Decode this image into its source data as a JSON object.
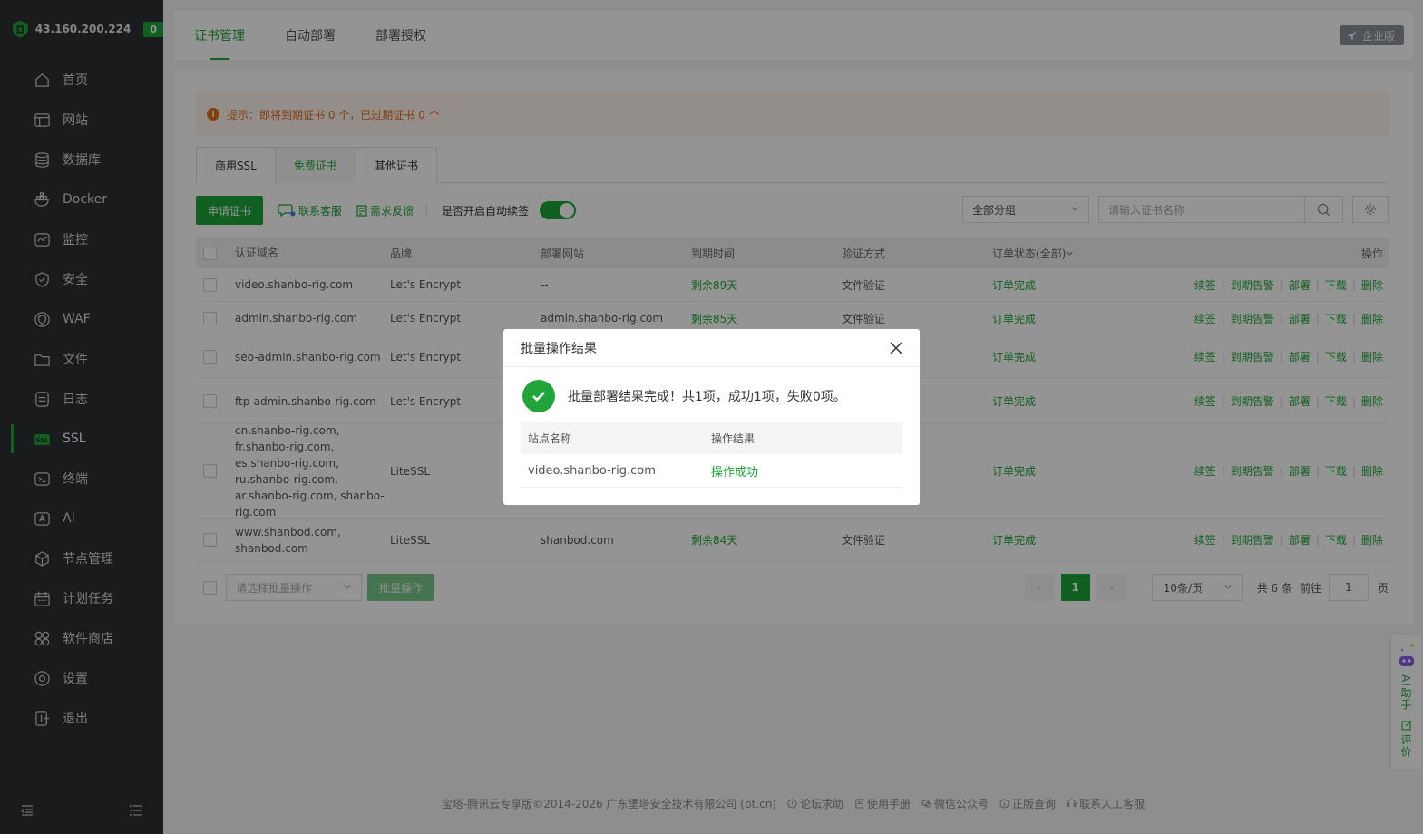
{
  "sidebar": {
    "ip": "43.160.200.224",
    "count": "0",
    "items": [
      {
        "label": "首页",
        "icon": "home-icon"
      },
      {
        "label": "网站",
        "icon": "website-icon"
      },
      {
        "label": "数据库",
        "icon": "database-icon"
      },
      {
        "label": "Docker",
        "icon": "docker-icon"
      },
      {
        "label": "监控",
        "icon": "monitor-icon"
      },
      {
        "label": "安全",
        "icon": "shield-icon"
      },
      {
        "label": "WAF",
        "icon": "waf-icon"
      },
      {
        "label": "文件",
        "icon": "folder-icon"
      },
      {
        "label": "日志",
        "icon": "log-icon"
      },
      {
        "label": "SSL",
        "icon": "ssl-icon"
      },
      {
        "label": "终端",
        "icon": "terminal-icon"
      },
      {
        "label": "AI",
        "icon": "ai-icon"
      },
      {
        "label": "节点管理",
        "icon": "node-icon"
      },
      {
        "label": "计划任务",
        "icon": "calendar-icon"
      },
      {
        "label": "软件商店",
        "icon": "store-icon"
      },
      {
        "label": "设置",
        "icon": "settings-icon"
      },
      {
        "label": "退出",
        "icon": "logout-icon"
      }
    ],
    "active": "SSL"
  },
  "topbar": {
    "tabs": [
      "证书管理",
      "自动部署",
      "部署授权"
    ],
    "enterprise": "企业版"
  },
  "notice": "提示：即将到期证书 0 个，已过期证书 0 个",
  "subtabs": [
    "商用SSL",
    "免费证书",
    "其他证书"
  ],
  "toolbar": {
    "apply": "申请证书",
    "contact": "联系客服",
    "feedback": "需求反馈",
    "auto_renew_label": "是否开启自动续签",
    "auto_renew_on": true,
    "group_select": "全部分组",
    "search_placeholder": "请输入证书名称"
  },
  "table": {
    "headers": [
      "认证域名",
      "品牌",
      "部署网站",
      "到期时间",
      "验证方式",
      "订单状态(全部)",
      "操作"
    ],
    "actions": [
      "续签",
      "到期告警",
      "部署",
      "下载",
      "删除"
    ],
    "rows": [
      {
        "domain": "video.shanbo-rig.com",
        "brand": "Let's Encrypt",
        "site": "--",
        "expire": "剩余89天",
        "verify": "文件验证",
        "status": "订单完成"
      },
      {
        "domain": "admin.shanbo-rig.com",
        "brand": "Let's Encrypt",
        "site": "admin.shanbo-rig.com",
        "expire": "剩余85天",
        "verify": "文件验证",
        "status": "订单完成"
      },
      {
        "domain": "seo-admin.shanbo-rig.com",
        "brand": "Let's Encrypt",
        "site": "",
        "expire": "",
        "verify": "",
        "status": "订单完成"
      },
      {
        "domain": "ftp-admin.shanbo-rig.com",
        "brand": "Let's Encrypt",
        "site": "",
        "expire": "",
        "verify": "",
        "status": "订单完成"
      },
      {
        "domain": "cn.shanbo-rig.com, fr.shanbo-rig.com, es.shanbo-rig.com, ru.shanbo-rig.com, ar.shanbo-rig.com, shanbo-rig.com",
        "brand": "LiteSSL",
        "site": "",
        "expire": "",
        "verify": "",
        "status": "订单完成"
      },
      {
        "domain": "www.shanbod.com, shanbod.com",
        "brand": "LiteSSL",
        "site": "shanbod.com",
        "expire": "剩余84天",
        "verify": "文件验证",
        "status": "订单完成"
      }
    ]
  },
  "footer_bar": {
    "batch_placeholder": "请选择批量操作",
    "batch_btn": "批量操作",
    "page": "1",
    "per_page": "10条/页",
    "total": "共 6 条",
    "goto": "前往",
    "goto_value": "1",
    "page_unit": "页"
  },
  "ai_widget": {
    "assistant": "AI助手",
    "review": "评价"
  },
  "site_footer": {
    "copyright": "宝塔-腾讯云专享版©2014-2026 广东堡塔安全技术有限公司 (bt.cn)",
    "links": [
      "论坛求助",
      "使用手册",
      "微信公众号",
      "正版查询",
      "联系人工客服"
    ]
  },
  "modal": {
    "title": "批量操作结果",
    "message": "批量部署结果完成！共1项，成功1项，失败0项。",
    "headers": [
      "站点名称",
      "操作结果"
    ],
    "rows": [
      {
        "site": "video.shanbo-rig.com",
        "result": "操作成功"
      }
    ]
  },
  "colors": {
    "accent": "#20a53a",
    "sidebar_bg": "#2c2f33",
    "warning": "#e46b1c"
  }
}
